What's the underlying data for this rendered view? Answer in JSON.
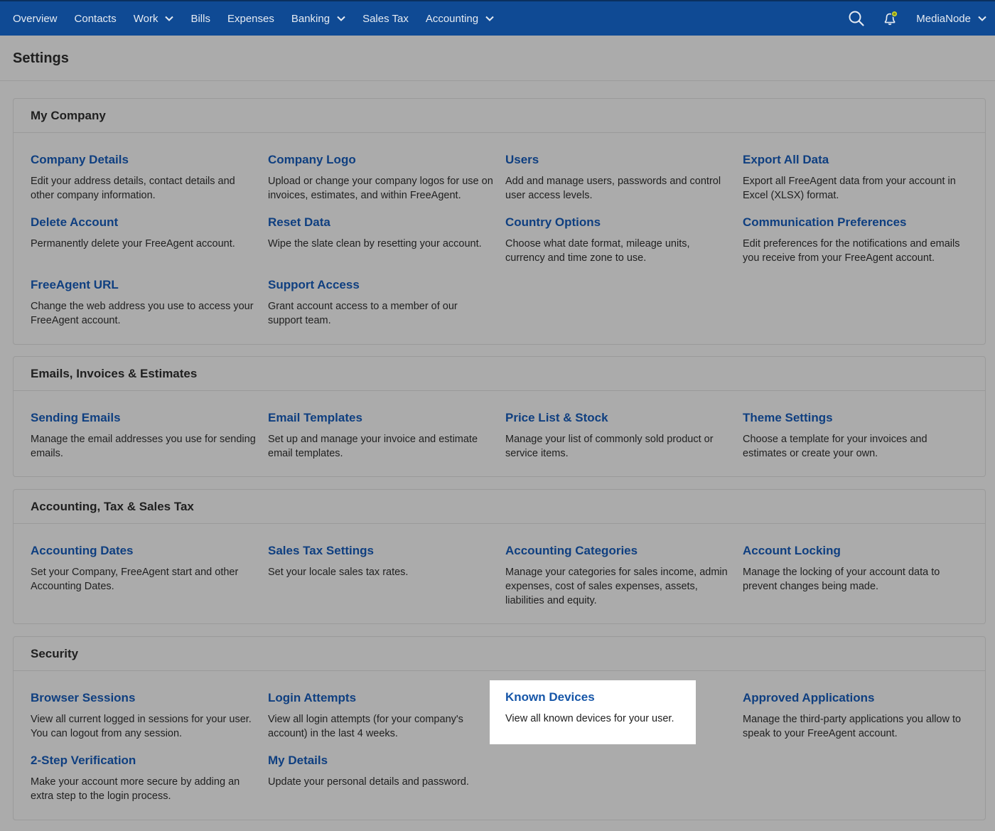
{
  "nav": {
    "items": [
      {
        "label": "Overview",
        "dropdown": false
      },
      {
        "label": "Contacts",
        "dropdown": false
      },
      {
        "label": "Work",
        "dropdown": true
      },
      {
        "label": "Bills",
        "dropdown": false
      },
      {
        "label": "Expenses",
        "dropdown": false
      },
      {
        "label": "Banking",
        "dropdown": true
      },
      {
        "label": "Sales Tax",
        "dropdown": false
      },
      {
        "label": "Accounting",
        "dropdown": true
      }
    ],
    "user": "MediaNode",
    "search_icon": "search-icon",
    "notification_icon": "bell-icon"
  },
  "page": {
    "title": "Settings"
  },
  "colors": {
    "nav_bg": "#0f4a94",
    "link": "#0f3f80",
    "highlight_link": "#1656a8"
  },
  "sections": [
    {
      "title": "My Company",
      "items": [
        {
          "title": "Company Details",
          "desc": "Edit your address details, contact details and other company information."
        },
        {
          "title": "Company Logo",
          "desc": "Upload or change your company logos for use on invoices, estimates, and within FreeAgent."
        },
        {
          "title": "Users",
          "desc": "Add and manage users, passwords and control user access levels."
        },
        {
          "title": "Export All Data",
          "desc": "Export all FreeAgent data from your account in Excel (XLSX) format."
        },
        {
          "title": "Delete Account",
          "desc": "Permanently delete your FreeAgent account."
        },
        {
          "title": "Reset Data",
          "desc": "Wipe the slate clean by resetting your account."
        },
        {
          "title": "Country Options",
          "desc": "Choose what date format, mileage units, currency and time zone to use."
        },
        {
          "title": "Communication Preferences",
          "desc": "Edit preferences for the notifications and emails you receive from your FreeAgent account."
        },
        {
          "title": "FreeAgent URL",
          "desc": "Change the web address you use to access your FreeAgent account."
        },
        {
          "title": "Support Access",
          "desc": "Grant account access to a member of our support team."
        }
      ]
    },
    {
      "title": "Emails, Invoices & Estimates",
      "items": [
        {
          "title": "Sending Emails",
          "desc": "Manage the email addresses you use for sending emails."
        },
        {
          "title": "Email Templates",
          "desc": "Set up and manage your invoice and estimate email templates."
        },
        {
          "title": "Price List & Stock",
          "desc": "Manage your list of commonly sold product or service items."
        },
        {
          "title": "Theme Settings",
          "desc": "Choose a template for your invoices and estimates or create your own."
        }
      ]
    },
    {
      "title": "Accounting, Tax & Sales Tax",
      "items": [
        {
          "title": "Accounting Dates",
          "desc": "Set your Company, FreeAgent start and other Accounting Dates."
        },
        {
          "title": "Sales Tax Settings",
          "desc": "Set your locale sales tax rates."
        },
        {
          "title": "Accounting Categories",
          "desc": "Manage your categories for sales income, admin expenses, cost of sales expenses, assets, liabilities and equity."
        },
        {
          "title": "Account Locking",
          "desc": "Manage the locking of your account data to prevent changes being made."
        }
      ]
    },
    {
      "title": "Security",
      "items": [
        {
          "title": "Browser Sessions",
          "desc": "View all current logged in sessions for your user. You can logout from any session."
        },
        {
          "title": "Login Attempts",
          "desc": "View all login attempts (for your company's account) in the last 4 weeks."
        },
        {
          "title": "Known Devices",
          "desc": "View all known devices for your user."
        },
        {
          "title": "Approved Applications",
          "desc": "Manage the third-party applications you allow to speak to your FreeAgent account."
        },
        {
          "title": "2-Step Verification",
          "desc": "Make your account more secure by adding an extra step to the login process."
        },
        {
          "title": "My Details",
          "desc": "Update your personal details and password."
        }
      ]
    }
  ]
}
